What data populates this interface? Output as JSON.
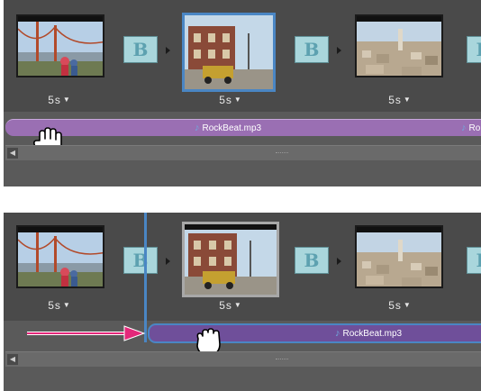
{
  "panels": [
    {
      "selected_clip": 2,
      "clips": [
        {
          "duration": "5s",
          "icon": "golden-gate-photo"
        },
        {
          "duration": "5s",
          "icon": "victorian-house-photo"
        },
        {
          "duration": "5s",
          "icon": "city-skyline-photo"
        }
      ],
      "transitions": [
        "B",
        "B",
        "B"
      ],
      "audio": {
        "note_icon": "♪",
        "file": "RockBeat.mp3",
        "file_repeat": "Ro"
      }
    },
    {
      "selected_clip": 2,
      "clips": [
        {
          "duration": "5s",
          "icon": "golden-gate-photo"
        },
        {
          "duration": "5s",
          "icon": "victorian-house-photo"
        },
        {
          "duration": "5s",
          "icon": "city-skyline-photo"
        }
      ],
      "transitions": [
        "B",
        "B",
        "B"
      ],
      "audio": {
        "note_icon": "♪",
        "file": "RockBeat.mp3"
      }
    }
  ],
  "colors": {
    "audio_track": "#9a6fb3",
    "audio_track_dragging": "#6f4f9a",
    "selection_blue": "#4a86c4",
    "drag_arrow": "#e4287a",
    "insert_line": "#4a86c4"
  }
}
